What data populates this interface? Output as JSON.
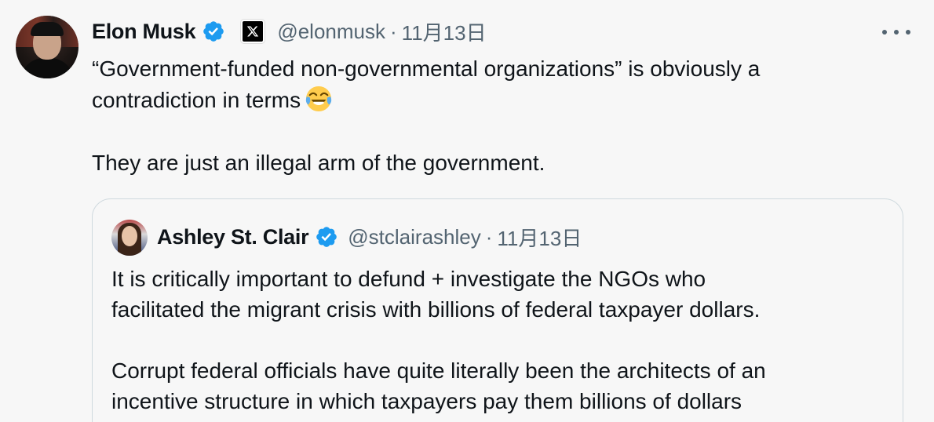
{
  "tweet": {
    "author_name": "Elon Musk",
    "author_handle": "@elonmusk",
    "separator": "·",
    "date": "11月13日",
    "line1": "“Government-funded non-governmental organizations” is obviously a",
    "line2": "contradiction in terms",
    "emoji": "face-with-tears-of-joy",
    "line3": "They are just an illegal arm of the government.",
    "badges": [
      "verified-badge-icon",
      "x-affiliation-icon"
    ],
    "more_icon": "more-options-icon"
  },
  "quote": {
    "author_name": "Ashley St. Clair",
    "author_handle": "@stclairashley",
    "separator": "·",
    "date": "11月13日",
    "para1_line1": "It is critically important to defund + investigate the NGOs who",
    "para1_line2": "facilitated the migrant crisis with billions of federal taxpayer dollars.",
    "para2_line1": "Corrupt federal officials have quite literally been the architects of an",
    "para2_line2": "incentive structure in which taxpayers pay them billions of dollars"
  },
  "colors": {
    "background": "#f7f7f7",
    "text_primary": "#0f1419",
    "text_secondary": "#536471",
    "verified_blue": "#1d9bf0",
    "border": "#cfd9de"
  }
}
